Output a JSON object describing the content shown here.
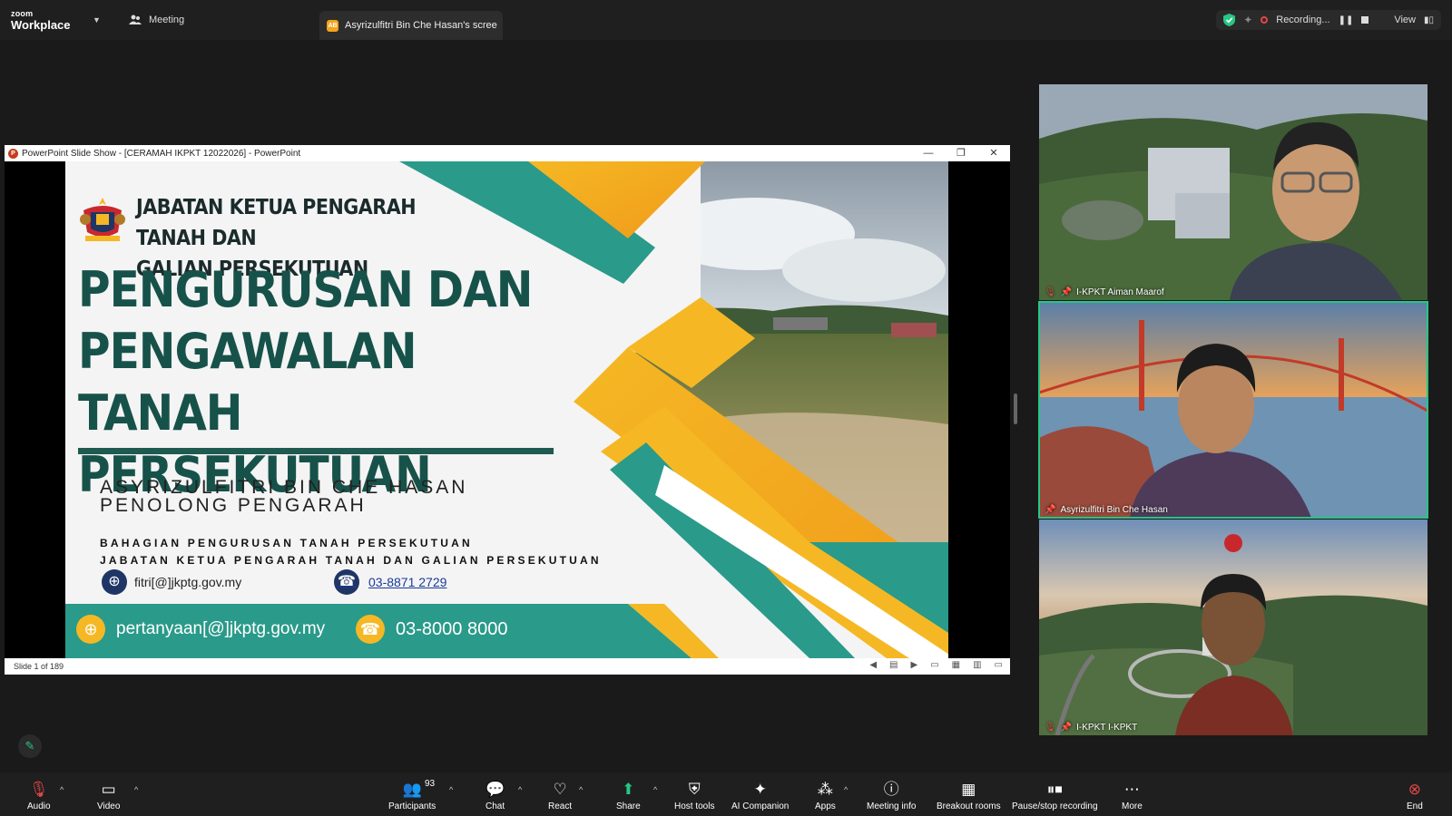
{
  "app": {
    "logo_top": "zoom",
    "logo_bottom": "Workplace"
  },
  "tabs": {
    "meeting": "Meeting",
    "share": "Asyrizulfitri Bin Che Hasan's scree",
    "share_initials": "AB"
  },
  "status": {
    "recording": "Recording...",
    "view": "View"
  },
  "ppt": {
    "window_title": "PowerPoint Slide Show - [CERAMAH IKPKT 12022026] - PowerPoint",
    "slide_counter": "Slide 1 of 189"
  },
  "slide": {
    "dept_line1": "JABATAN KETUA PENGARAH TANAH DAN",
    "dept_line2": "GALIAN PERSEKUTUAN",
    "title_line1": "PENGURUSAN DAN",
    "title_line2": "PENGAWALAN TANAH",
    "title_line3": "PERSEKUTUAN",
    "presenter_name": "ASYRIZULFITRI BIN CHE HASAN",
    "presenter_role": "PENOLONG PENGARAH",
    "division1": "BAHAGIAN PENGURUSAN TANAH PERSEKUTUAN",
    "division2": "JABATAN KETUA PENGARAH TANAH DAN GALIAN PERSEKUTUAN",
    "email": "fitri[@]jkptg.gov.my",
    "phone": "03-8871 2729",
    "footer_email": "pertanyaan[@]jkptg.gov.my",
    "footer_phone": "03-8000 8000"
  },
  "participants": [
    {
      "name": "I-KPKT Aiman Maarof"
    },
    {
      "name": "Asyrizulfitri Bin Che Hasan"
    },
    {
      "name": "I-KPKT I-KPKT"
    }
  ],
  "toolbar": {
    "audio": "Audio",
    "video": "Video",
    "participants": "Participants",
    "participants_count": "93",
    "chat": "Chat",
    "react": "React",
    "share": "Share",
    "host_tools": "Host tools",
    "ai_companion": "AI Companion",
    "apps": "Apps",
    "meeting_info": "Meeting info",
    "breakout": "Breakout rooms",
    "pause_rec": "Pause/stop recording",
    "more": "More",
    "end": "End"
  },
  "colors": {
    "accent_green": "#27c685",
    "slide_teal": "#2a9a8a",
    "slide_yellow": "#f5b824",
    "title_green": "#17524a"
  }
}
